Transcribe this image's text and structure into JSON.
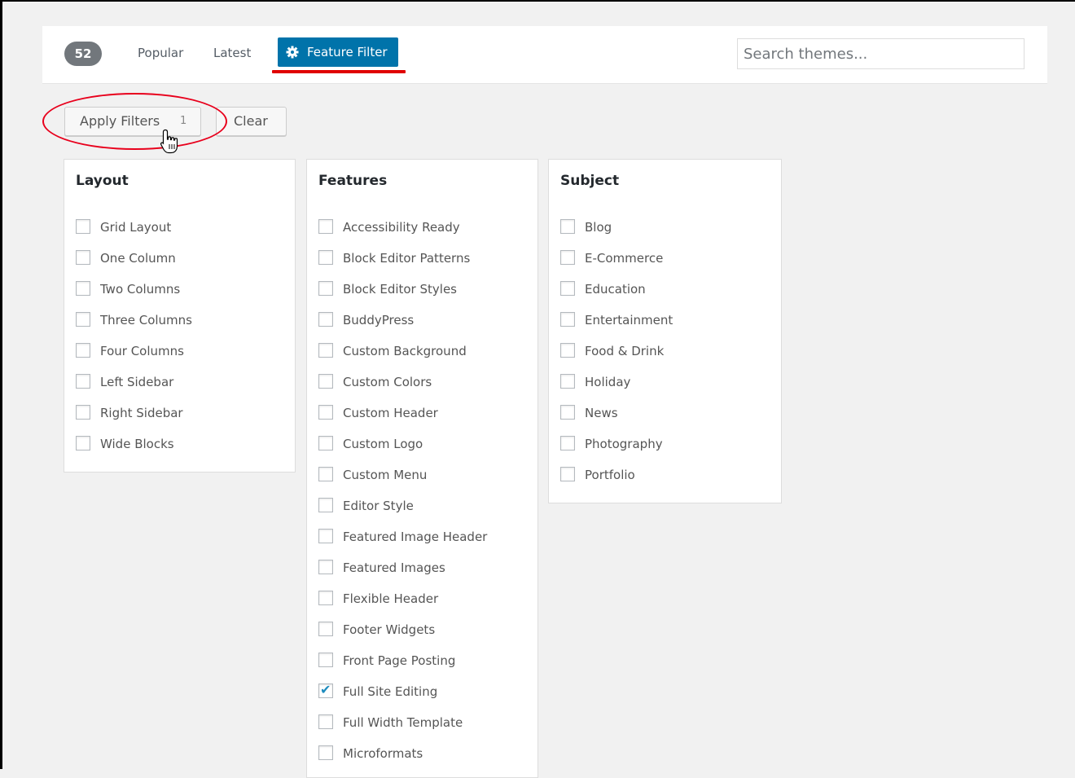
{
  "header": {
    "theme_count": "52",
    "tabs": {
      "popular": "Popular",
      "latest": "Latest",
      "feature_filter": "Feature Filter"
    },
    "search": {
      "placeholder": "Search themes...",
      "value": ""
    }
  },
  "actions": {
    "apply_label": "Apply Filters",
    "apply_count": "1",
    "clear_label": "Clear"
  },
  "filters": {
    "layout": {
      "title": "Layout",
      "options": [
        {
          "label": "Grid Layout",
          "checked": false
        },
        {
          "label": "One Column",
          "checked": false
        },
        {
          "label": "Two Columns",
          "checked": false
        },
        {
          "label": "Three Columns",
          "checked": false
        },
        {
          "label": "Four Columns",
          "checked": false
        },
        {
          "label": "Left Sidebar",
          "checked": false
        },
        {
          "label": "Right Sidebar",
          "checked": false
        },
        {
          "label": "Wide Blocks",
          "checked": false
        }
      ]
    },
    "features": {
      "title": "Features",
      "options": [
        {
          "label": "Accessibility Ready",
          "checked": false
        },
        {
          "label": "Block Editor Patterns",
          "checked": false
        },
        {
          "label": "Block Editor Styles",
          "checked": false
        },
        {
          "label": "BuddyPress",
          "checked": false
        },
        {
          "label": "Custom Background",
          "checked": false
        },
        {
          "label": "Custom Colors",
          "checked": false
        },
        {
          "label": "Custom Header",
          "checked": false
        },
        {
          "label": "Custom Logo",
          "checked": false
        },
        {
          "label": "Custom Menu",
          "checked": false
        },
        {
          "label": "Editor Style",
          "checked": false
        },
        {
          "label": "Featured Image Header",
          "checked": false
        },
        {
          "label": "Featured Images",
          "checked": false
        },
        {
          "label": "Flexible Header",
          "checked": false
        },
        {
          "label": "Footer Widgets",
          "checked": false
        },
        {
          "label": "Front Page Posting",
          "checked": false
        },
        {
          "label": "Full Site Editing",
          "checked": true
        },
        {
          "label": "Full Width Template",
          "checked": false
        },
        {
          "label": "Microformats",
          "checked": false
        }
      ]
    },
    "subject": {
      "title": "Subject",
      "options": [
        {
          "label": "Blog",
          "checked": false
        },
        {
          "label": "E-Commerce",
          "checked": false
        },
        {
          "label": "Education",
          "checked": false
        },
        {
          "label": "Entertainment",
          "checked": false
        },
        {
          "label": "Food & Drink",
          "checked": false
        },
        {
          "label": "Holiday",
          "checked": false
        },
        {
          "label": "News",
          "checked": false
        },
        {
          "label": "Photography",
          "checked": false
        },
        {
          "label": "Portfolio",
          "checked": false
        }
      ]
    }
  },
  "colors": {
    "accent": "#0073aa",
    "annotation_red": "#e00000",
    "highlight": "#f7f700"
  },
  "icons": {
    "feature_tab": "gear-icon",
    "checked": "checkmark-icon",
    "cursor": "hand-pointer-icon"
  }
}
